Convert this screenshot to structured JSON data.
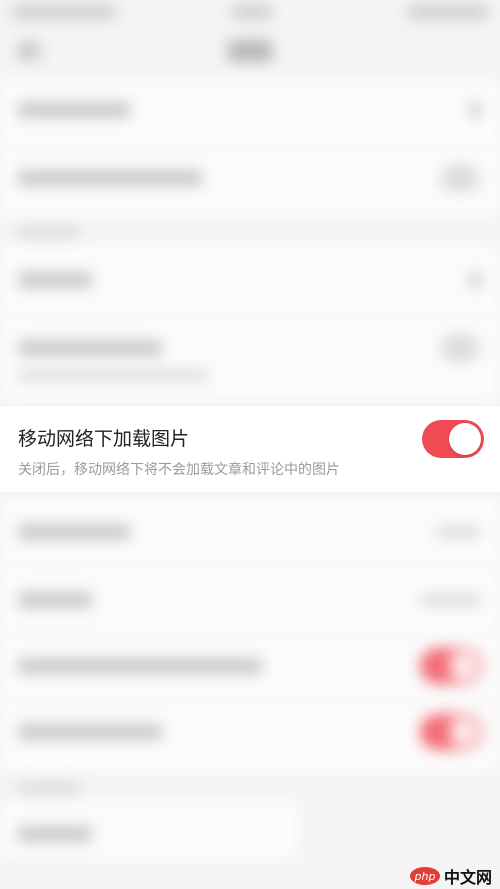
{
  "setting": {
    "title": "移动网络下加载图片",
    "description": "关闭后，移动网络下将不会加载文章和评论中的图片",
    "enabled": true
  },
  "watermark": {
    "logo": "php",
    "text": "中文网"
  },
  "colors": {
    "toggle_on": "#f04a52",
    "background": "#f4f4f4"
  }
}
